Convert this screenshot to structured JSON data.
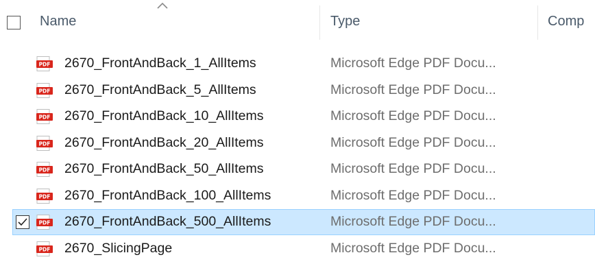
{
  "header": {
    "columns": [
      {
        "label": "Name"
      },
      {
        "label": "Type"
      },
      {
        "label": "Comp"
      }
    ],
    "sort": {
      "column": "Name",
      "direction": "ascending"
    }
  },
  "files": [
    {
      "name": "2670_FrontAndBack_1_AllItems",
      "type": "Microsoft Edge PDF Docu...",
      "icon": "pdf-icon",
      "selected": false
    },
    {
      "name": "2670_FrontAndBack_5_AllItems",
      "type": "Microsoft Edge PDF Docu...",
      "icon": "pdf-icon",
      "selected": false
    },
    {
      "name": "2670_FrontAndBack_10_AllItems",
      "type": "Microsoft Edge PDF Docu...",
      "icon": "pdf-icon",
      "selected": false
    },
    {
      "name": "2670_FrontAndBack_20_AllItems",
      "type": "Microsoft Edge PDF Docu...",
      "icon": "pdf-icon",
      "selected": false
    },
    {
      "name": "2670_FrontAndBack_50_AllItems",
      "type": "Microsoft Edge PDF Docu...",
      "icon": "pdf-icon",
      "selected": false
    },
    {
      "name": "2670_FrontAndBack_100_AllItems",
      "type": "Microsoft Edge PDF Docu...",
      "icon": "pdf-icon",
      "selected": false
    },
    {
      "name": "2670_FrontAndBack_500_AllItems",
      "type": "Microsoft Edge PDF Docu...",
      "icon": "pdf-icon",
      "selected": true
    },
    {
      "name": "2670_SlicingPage",
      "type": "Microsoft Edge PDF Docu...",
      "icon": "pdf-icon",
      "selected": false
    }
  ],
  "colors": {
    "selection_bg": "#cce8ff",
    "selection_border": "#99d1ff",
    "pdf_red": "#d9261c"
  },
  "icons": {
    "pdf_label": "PDF"
  }
}
